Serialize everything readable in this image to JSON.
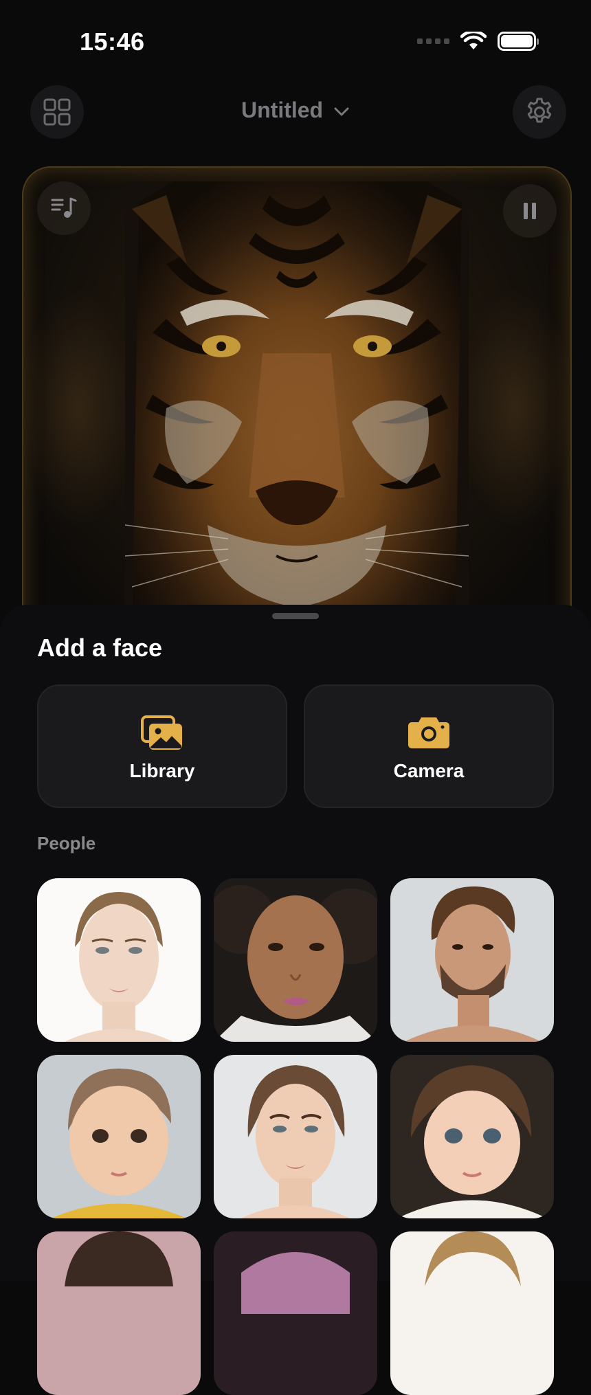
{
  "status_bar": {
    "time": "15:46"
  },
  "header": {
    "title": "Untitled"
  },
  "sheet": {
    "title": "Add a face",
    "actions": [
      {
        "label": "Library",
        "icon": "photo-library-icon"
      },
      {
        "label": "Camera",
        "icon": "camera-icon"
      }
    ],
    "section_label": "People"
  },
  "colors": {
    "accent": "#e4b04a",
    "background": "#0a0a0b",
    "card": "#1a1a1c"
  }
}
